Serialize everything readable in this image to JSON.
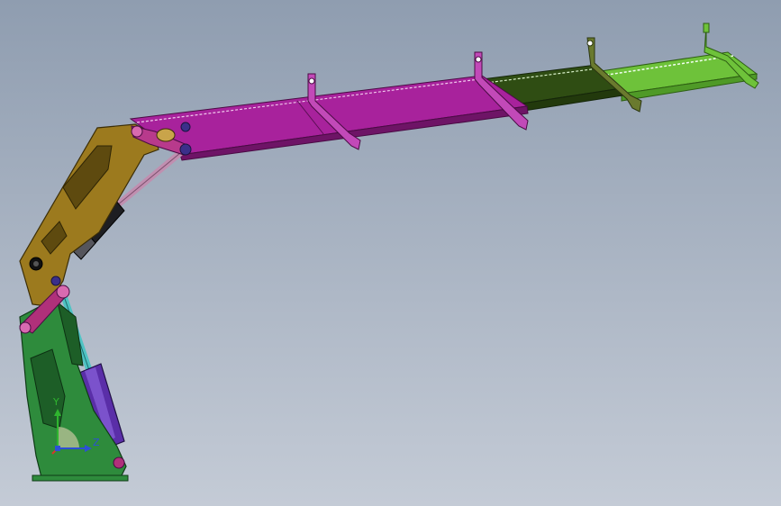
{
  "viewport": {
    "background_top": "#8f9db0",
    "background_bottom": "#c4cbd6"
  },
  "colors": {
    "base": "#2e8b3c",
    "base_dark": "#1d5e27",
    "inner_boom": "#9c7a1e",
    "inner_boom_dark": "#5e4a0f",
    "outer_boom": "#a8229c",
    "outer_boom_dark": "#6e1466",
    "ext_dark_green": "#2f4d13",
    "ext_light_green": "#6ec23a",
    "cylinder_main": "#5a2ea8",
    "cylinder_rod": "#4fc3c3",
    "cylinder_upper": "#c08fb0",
    "link": "#b0307a",
    "pin": "#3b2f8a"
  },
  "triad": {
    "x_label": "X",
    "y_label": "Y",
    "z_label": "Z",
    "x_color": "#d8362b",
    "y_color": "#2fb52f",
    "z_color": "#2d4fd6"
  }
}
